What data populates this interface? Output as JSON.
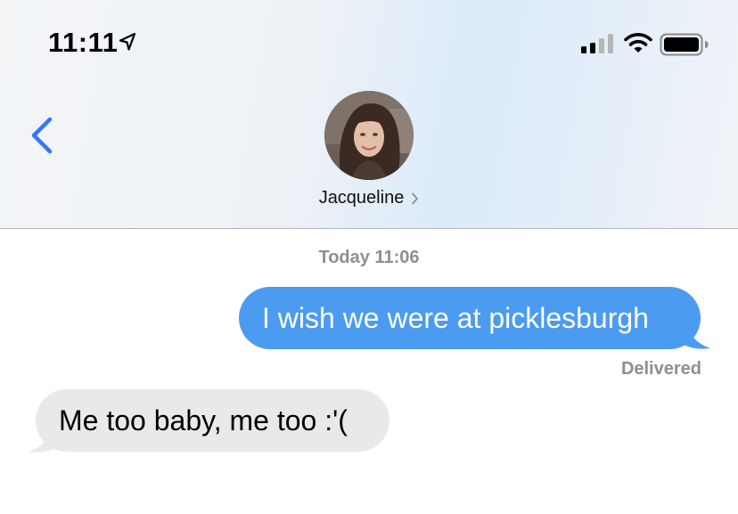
{
  "status_bar": {
    "time": "11:11",
    "location_icon": "location-arrow-icon",
    "signal_icon": "cellular-signal-icon",
    "wifi_icon": "wifi-icon",
    "battery_icon": "battery-icon"
  },
  "header": {
    "back_icon": "chevron-left-icon",
    "contact_name": "Jacqueline",
    "contact_chevron_icon": "chevron-right-icon",
    "accent_color": "#3478f6"
  },
  "conversation": {
    "timestamp": "Today 11:06",
    "messages": [
      {
        "direction": "sent",
        "text": "I wish we were at picklesburgh",
        "color": "#4b9cf1"
      },
      {
        "direction": "received",
        "text": "Me too baby, me too :'(",
        "color": "#e9e9eb"
      }
    ],
    "delivery_status": "Delivered"
  }
}
